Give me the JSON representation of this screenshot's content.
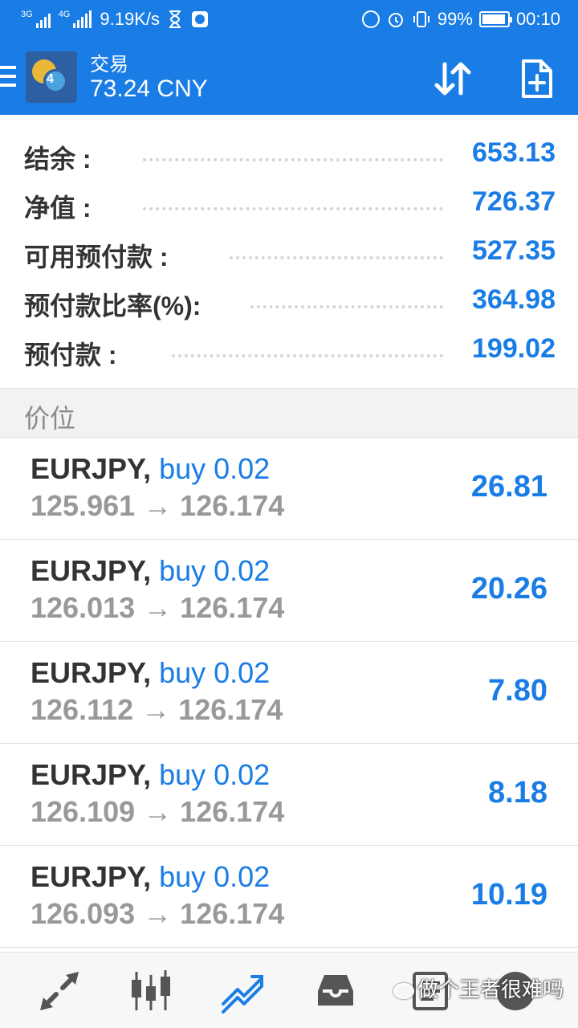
{
  "status_bar": {
    "network1": "3G",
    "network2": "4G",
    "speed": "9.19K/s",
    "battery": "99%",
    "time": "00:10"
  },
  "header": {
    "title": "交易",
    "balance_line": "73.24 CNY",
    "logo_number": "4"
  },
  "summary": [
    {
      "label": "结余 :",
      "value": "653.13"
    },
    {
      "label": "净值 :",
      "value": "726.37"
    },
    {
      "label": "可用预付款 :",
      "value": "527.35"
    },
    {
      "label": "预付款比率(%):",
      "value": "364.98"
    },
    {
      "label": "预付款 :",
      "value": "199.02"
    }
  ],
  "section_title": "价位",
  "positions": [
    {
      "symbol": "EURJPY,",
      "side": "buy 0.02",
      "open": "125.961",
      "arrow": "→",
      "current": "126.174",
      "profit": "26.81"
    },
    {
      "symbol": "EURJPY,",
      "side": "buy 0.02",
      "open": "126.013",
      "arrow": "→",
      "current": "126.174",
      "profit": "20.26"
    },
    {
      "symbol": "EURJPY,",
      "side": "buy 0.02",
      "open": "126.112",
      "arrow": "→",
      "current": "126.174",
      "profit": "7.80"
    },
    {
      "symbol": "EURJPY,",
      "side": "buy 0.02",
      "open": "126.109",
      "arrow": "→",
      "current": "126.174",
      "profit": "8.18"
    },
    {
      "symbol": "EURJPY,",
      "side": "buy 0.02",
      "open": "126.093",
      "arrow": "→",
      "current": "126.174",
      "profit": "10.19"
    }
  ],
  "bottom_nav": [
    {
      "name": "quotes",
      "icon": "arrows-diagonal-icon"
    },
    {
      "name": "chart",
      "icon": "candlestick-icon"
    },
    {
      "name": "trade",
      "icon": "trend-icon",
      "active": true
    },
    {
      "name": "history",
      "icon": "inbox-icon"
    },
    {
      "name": "news",
      "icon": "news-icon"
    },
    {
      "name": "messages",
      "icon": "chat-icon"
    }
  ],
  "watermark": "做个王者很难吗",
  "colors": {
    "accent": "#1a7de6",
    "label_text": "#333333",
    "muted_text": "#999999",
    "section_bg": "#f2f2f2"
  }
}
